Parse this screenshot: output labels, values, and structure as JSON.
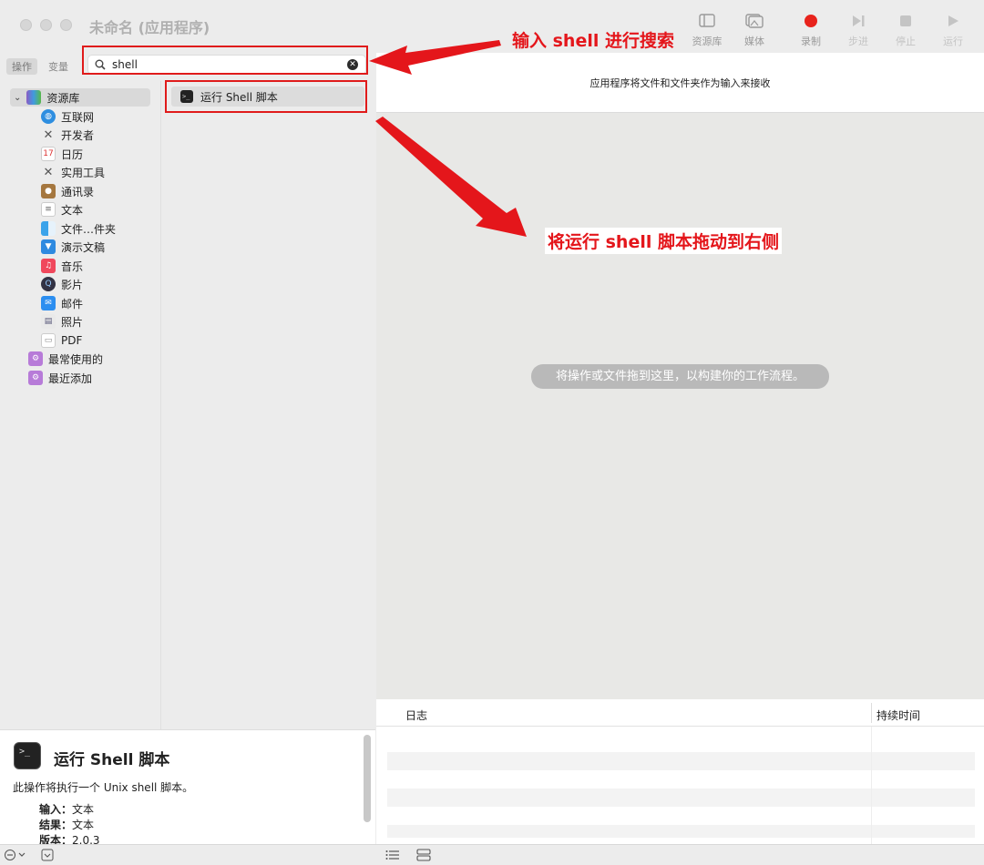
{
  "window": {
    "title": "未命名 (应用程序)"
  },
  "toolbar": {
    "library": "资源库",
    "media": "媒体",
    "record": "录制",
    "step": "步进",
    "stop": "停止",
    "run": "运行",
    "record_color": "#e8231c"
  },
  "tabs": {
    "actions": "操作",
    "variables": "变量"
  },
  "search": {
    "value": "shell"
  },
  "library": {
    "root": "资源库",
    "items": [
      "互联网",
      "开发者",
      "日历",
      "实用工具",
      "通讯录",
      "文本",
      "文件…件夹",
      "演示文稿",
      "音乐",
      "影片",
      "邮件",
      "照片",
      "PDF"
    ],
    "smart": [
      "最常使用的",
      "最近添加"
    ]
  },
  "results": {
    "items": [
      "运行 Shell 脚本"
    ]
  },
  "description": {
    "title": "运行 Shell 脚本",
    "text": "此操作将执行一个 Unix shell 脚本。",
    "input_label": "输入：",
    "input_value": "文本",
    "result_label": "结果：",
    "result_value": "文本",
    "version_label": "版本：",
    "version_value": "2.0.3"
  },
  "workflow": {
    "header": "应用程序将文件和文件夹作为输入来接收",
    "drop_hint": "将操作或文件拖到这里，以构建你的工作流程。"
  },
  "log": {
    "col_log": "日志",
    "col_duration": "持续时间"
  },
  "annotations": {
    "search_tip": "输入 shell 进行搜索",
    "drag_tip": "将运行 shell 脚本拖动到右侧",
    "color": "#e4161b"
  }
}
